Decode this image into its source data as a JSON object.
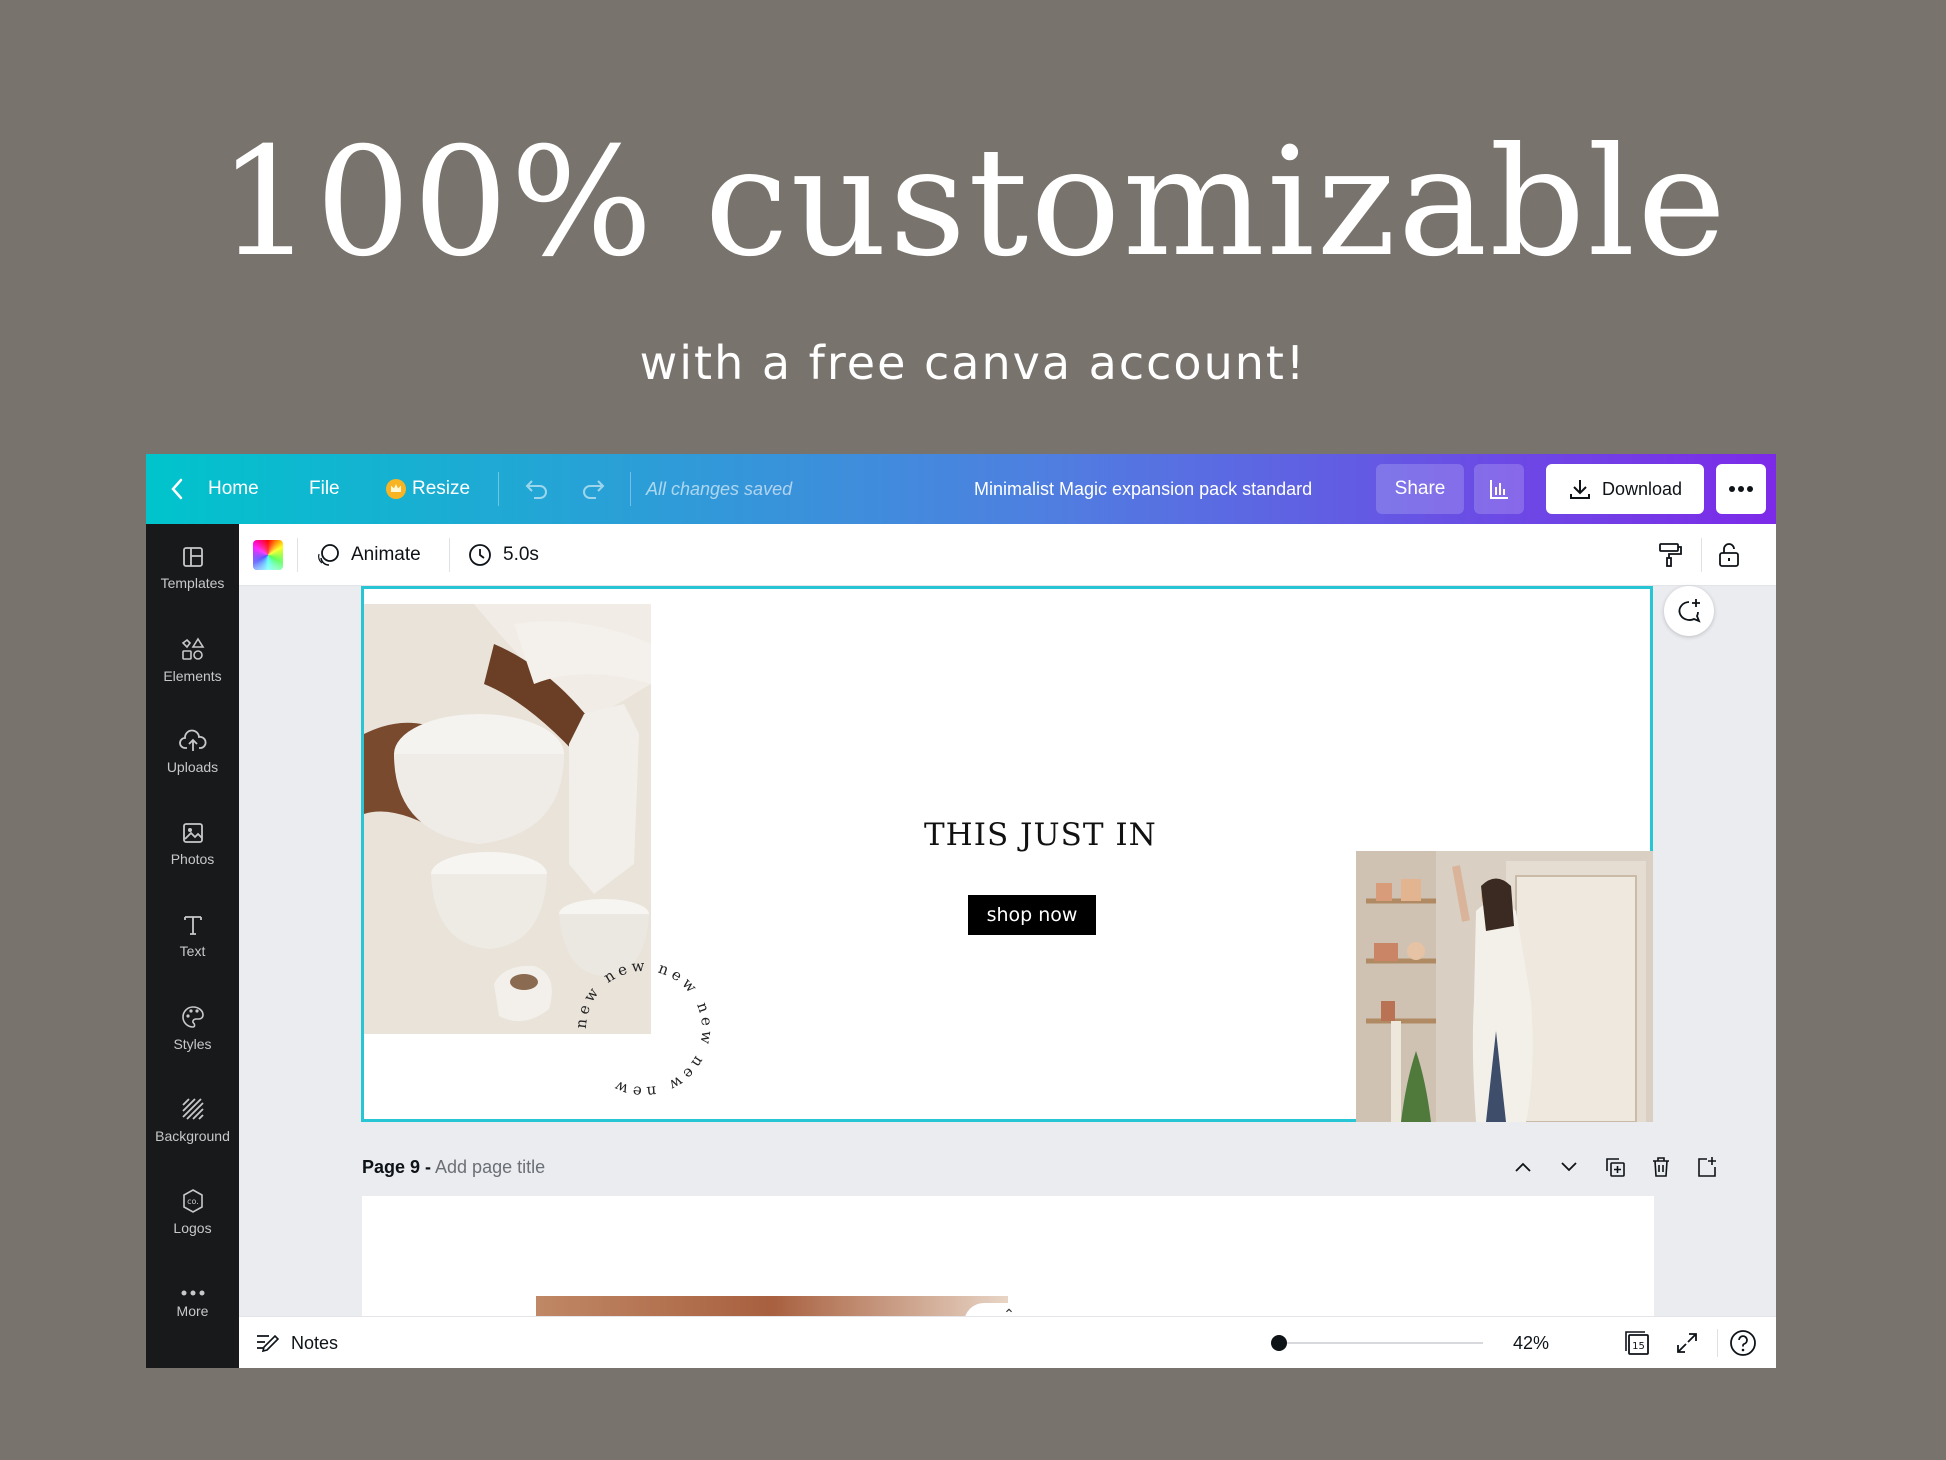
{
  "hero": {
    "title": "100% customizable",
    "subtitle": "with a free canva account!"
  },
  "topbar": {
    "home_label": "Home",
    "file_label": "File",
    "resize_label": "Resize",
    "save_status": "All changes saved",
    "document_title": "Minimalist Magic expansion pack standard",
    "share_label": "Share",
    "download_label": "Download"
  },
  "sidebar": {
    "items": [
      {
        "label": "Templates",
        "icon": "templates-icon"
      },
      {
        "label": "Elements",
        "icon": "elements-icon"
      },
      {
        "label": "Uploads",
        "icon": "uploads-icon"
      },
      {
        "label": "Photos",
        "icon": "photos-icon"
      },
      {
        "label": "Text",
        "icon": "text-icon"
      },
      {
        "label": "Styles",
        "icon": "styles-icon"
      },
      {
        "label": "Background",
        "icon": "background-icon"
      },
      {
        "label": "Logos",
        "icon": "logos-icon"
      },
      {
        "label": "More",
        "icon": "more-icon"
      }
    ]
  },
  "toolbar": {
    "animate_label": "Animate",
    "duration": "5.0s"
  },
  "canvas": {
    "headline": "THIS JUST IN",
    "cta_label": "shop now",
    "stamp_text": "new new new new new new"
  },
  "page_bar": {
    "page_label": "Page 9 -",
    "add_title_placeholder": "Add page title"
  },
  "bottombar": {
    "notes_label": "Notes",
    "zoom": "42%",
    "zoom_fraction": 0.03,
    "page_count": "15"
  },
  "colors": {
    "background": "#78736c",
    "gradient_start": "#00c4cc",
    "gradient_end": "#7d2ae8",
    "selection": "#28c5d4",
    "sidebar": "#18191b"
  }
}
